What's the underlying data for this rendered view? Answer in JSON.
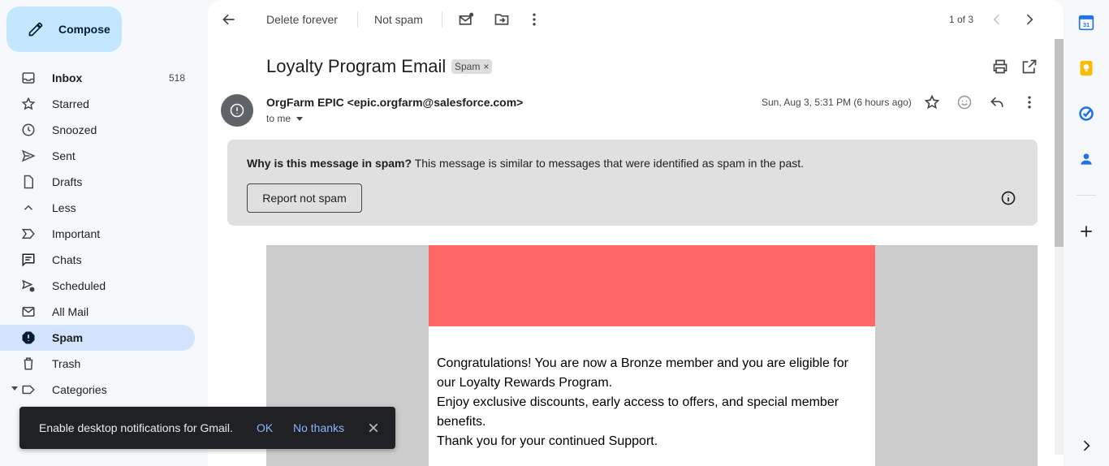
{
  "compose": {
    "label": "Compose"
  },
  "nav": [
    {
      "label": "Inbox",
      "count": "518"
    },
    {
      "label": "Starred",
      "count": ""
    },
    {
      "label": "Snoozed",
      "count": ""
    },
    {
      "label": "Sent",
      "count": ""
    },
    {
      "label": "Drafts",
      "count": ""
    },
    {
      "label": "Less",
      "count": ""
    },
    {
      "label": "Important",
      "count": ""
    },
    {
      "label": "Chats",
      "count": ""
    },
    {
      "label": "Scheduled",
      "count": ""
    },
    {
      "label": "All Mail",
      "count": ""
    },
    {
      "label": "Spam",
      "count": ""
    },
    {
      "label": "Trash",
      "count": ""
    },
    {
      "label": "Categories",
      "count": ""
    }
  ],
  "toolbar": {
    "delete_forever": "Delete forever",
    "not_spam": "Not spam",
    "pager": "1 of 3"
  },
  "message": {
    "subject": "Loyalty Program Email",
    "label_chip": "Spam",
    "label_chip_close": "×",
    "sender": "OrgFarm EPIC <epic.orgfarm@salesforce.com>",
    "to": "to me",
    "date": "Sun, Aug 3, 5:31 PM (6 hours ago)"
  },
  "spam_banner": {
    "title": "Why is this message in spam?",
    "text": " This message is similar to messages that were identified as spam in the past.",
    "button": "Report not spam"
  },
  "email": {
    "header_color": "#ff6666",
    "lines": [
      "Congratulations! You are now a Bronze member and you are eligible for our Loyalty Rewards Program.",
      "Enjoy exclusive discounts, early access to offers, and special member benefits.",
      "Thank you for your continued Support."
    ]
  },
  "snackbar": {
    "text": "Enable desktop notifications for Gmail.",
    "ok": "OK",
    "no_thanks": "No thanks"
  },
  "colors": {
    "compose_bg": "#c2e7ff",
    "active_nav_bg": "#d3e3fd",
    "link_blue": "#8ab4f8"
  }
}
